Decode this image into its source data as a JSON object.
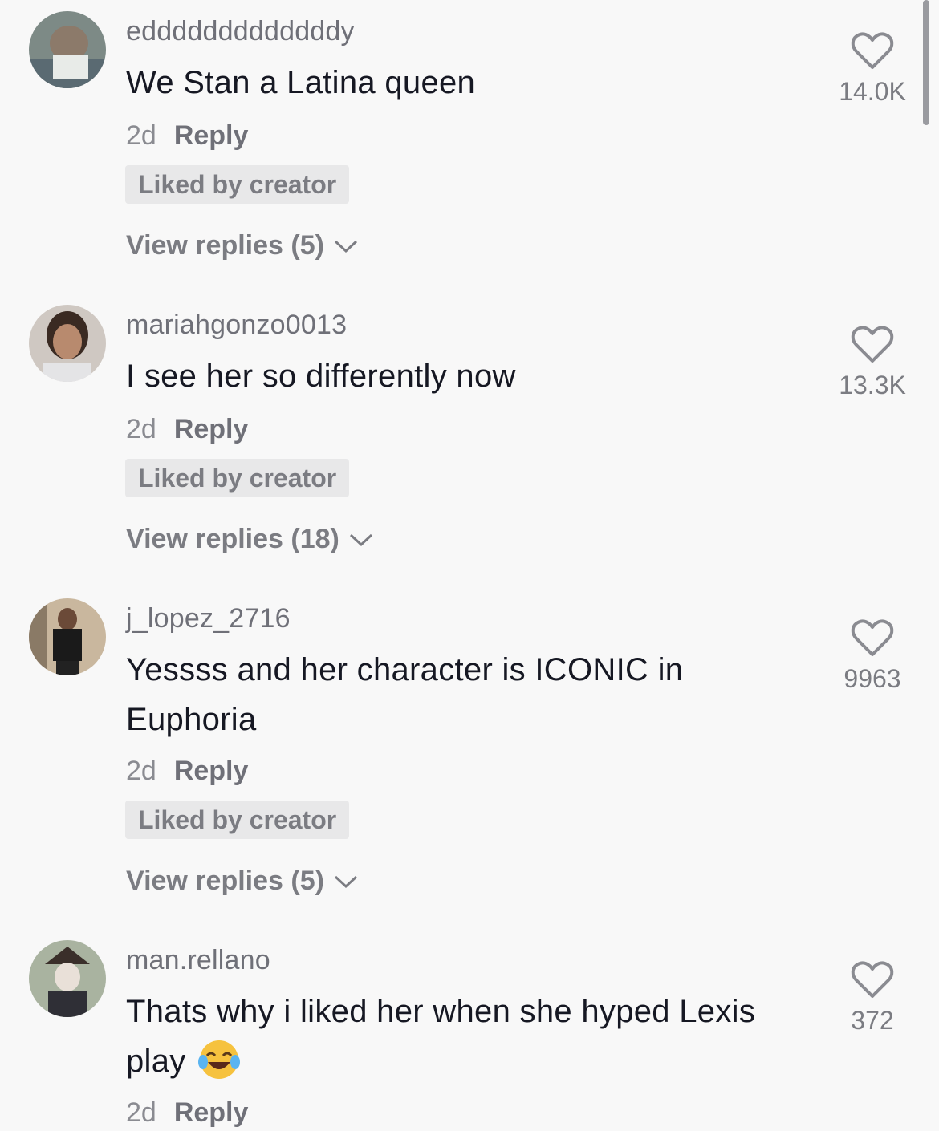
{
  "comments": [
    {
      "username": "edddddddddddddy",
      "text": "We Stan a Latina queen",
      "time": "2d",
      "reply_label": "Reply",
      "badge": "Liked by creator",
      "view_replies": "View replies (5)",
      "likes": "14.0K",
      "avatar_icon": "user-avatar"
    },
    {
      "username": "mariahgonzo0013",
      "text": "I see her so differently now",
      "time": "2d",
      "reply_label": "Reply",
      "badge": "Liked by creator",
      "view_replies": "View replies (18)",
      "likes": "13.3K",
      "avatar_icon": "user-avatar"
    },
    {
      "username": "j_lopez_2716",
      "text": "Yessss and her character is ICONIC in Euphoria",
      "time": "2d",
      "reply_label": "Reply",
      "badge": "Liked by creator",
      "view_replies": "View replies (5)",
      "likes": "9963",
      "avatar_icon": "user-avatar"
    },
    {
      "username": "man.rellano",
      "text": "Thats why i liked her when she hyped Lexis play",
      "time": "2d",
      "reply_label": "Reply",
      "likes": "372",
      "avatar_icon": "user-avatar",
      "emoji": "face-with-tears-of-joy"
    }
  ],
  "icons": {
    "like": "heart-outline-icon",
    "expand": "chevron-down-icon"
  },
  "colors": {
    "background": "#f8f8f8",
    "text_primary": "#161823",
    "text_secondary": "#7b7c82",
    "badge_bg": "#e8e8e9"
  }
}
